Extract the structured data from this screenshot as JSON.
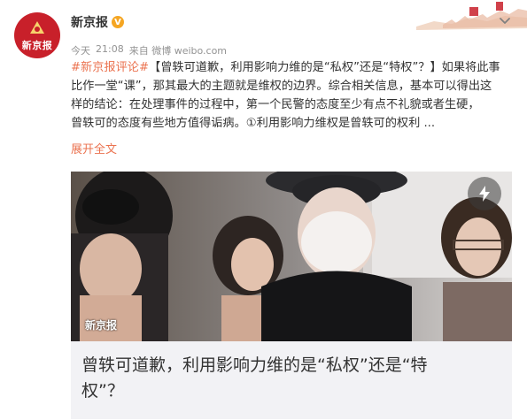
{
  "author": {
    "name": "新京报",
    "avatar_label": "新京报",
    "verified_badge": "V"
  },
  "meta": {
    "date": "今天",
    "time": "21:08",
    "source": "来自 微博 weibo.com"
  },
  "post": {
    "hashtag": "#新京报评论#",
    "lines": [
      "【曾轶可道歉，利用影响力维的是“私权”还是“特权”？】如果将此事",
      "比作一堂“课”，那其最大的主题就是维权的边界。综合相关信息，基本可以得出这",
      "样的结论：在处理事件的过程中，第一个民警的态度至少有点不礼貌或者生硬，",
      "曾轶可的态度有些地方值得诟病。①利用影响力维权是曾轶可的权利 ..."
    ],
    "expand_label": "展开全文"
  },
  "card": {
    "watermark": "新京报",
    "title_line1": "曾轶可道歉，利用影响力维的是“私权”还是“特",
    "title_line2": "权”？"
  },
  "colors": {
    "accent": "#eb7350",
    "brand_red": "#c8202a",
    "verified": "#f5a623"
  },
  "icons": {
    "verified": "verified-badge-icon",
    "menu": "chevron-down-icon",
    "flash": "lightning-icon"
  }
}
